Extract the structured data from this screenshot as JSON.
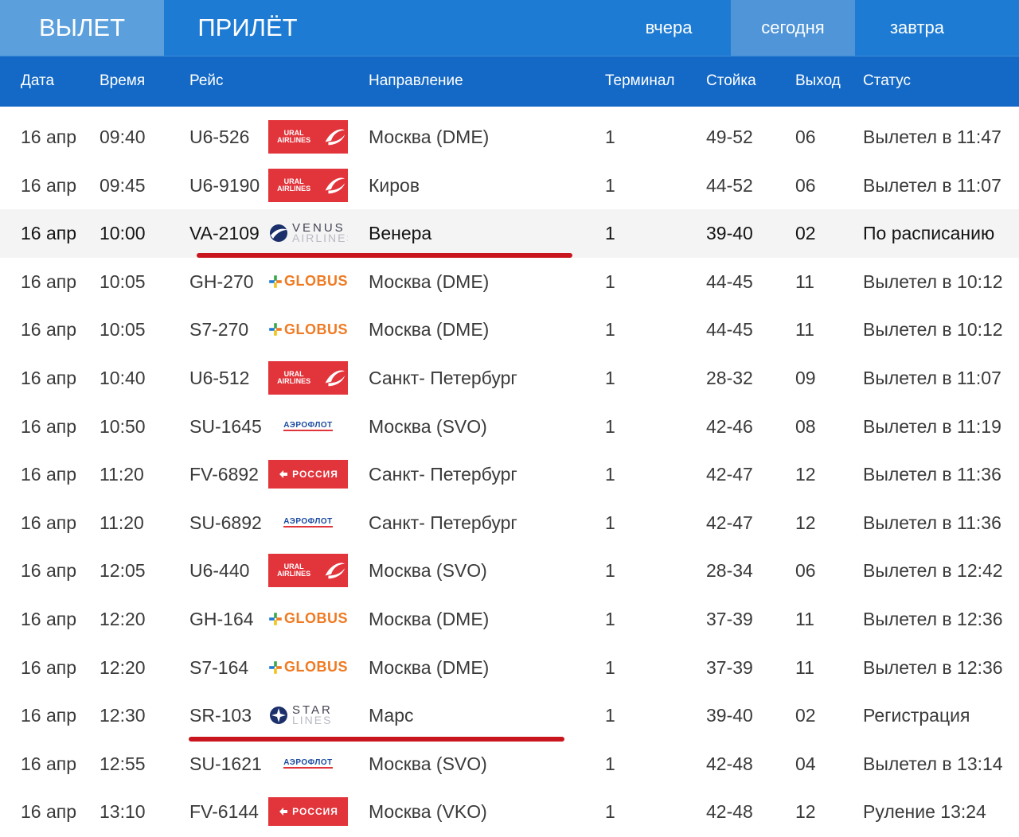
{
  "tabs": {
    "departure": "ВЫЛЕТ",
    "arrival": "ПРИЛЁТ"
  },
  "days": {
    "yesterday": "вчера",
    "today": "сегодня",
    "tomorrow": "завтра"
  },
  "columns": {
    "date": "Дата",
    "time": "Время",
    "flight": "Рейс",
    "direction": "Направление",
    "terminal": "Терминал",
    "desk": "Стойка",
    "gate": "Выход",
    "status": "Статус"
  },
  "colors": {
    "topbar": "#1e7bd3",
    "header": "#1469c6",
    "active_tab": "#5b9fdc",
    "underline": "#c8151e"
  },
  "flights": [
    {
      "date": "16 апр",
      "time": "09:40",
      "flight": "U6-526",
      "airline": "ural",
      "direction": "Москва (DME)",
      "terminal": "1",
      "desk": "49-52",
      "gate": "06",
      "status": "Вылетел в 11:47"
    },
    {
      "date": "16 апр",
      "time": "09:45",
      "flight": "U6-9190",
      "airline": "ural",
      "direction": "Киров",
      "terminal": "1",
      "desk": "44-52",
      "gate": "06",
      "status": "Вылетел в 11:07"
    },
    {
      "date": "16 апр",
      "time": "10:00",
      "flight": "VA-2109",
      "airline": "venus",
      "direction": "Венера",
      "terminal": "1",
      "desk": "39-40",
      "gate": "02",
      "status": "По расписанию",
      "highlight": true,
      "underlined": true
    },
    {
      "date": "16 апр",
      "time": "10:05",
      "flight": "GH-270",
      "airline": "globus",
      "direction": "Москва (DME)",
      "terminal": "1",
      "desk": "44-45",
      "gate": "11",
      "status": "Вылетел в 10:12"
    },
    {
      "date": "16 апр",
      "time": "10:05",
      "flight": "S7-270",
      "airline": "globus",
      "direction": "Москва (DME)",
      "terminal": "1",
      "desk": "44-45",
      "gate": "11",
      "status": "Вылетел в 10:12"
    },
    {
      "date": "16 апр",
      "time": "10:40",
      "flight": "U6-512",
      "airline": "ural",
      "direction": "Санкт- Петербург",
      "terminal": "1",
      "desk": "28-32",
      "gate": "09",
      "status": "Вылетел в 11:07"
    },
    {
      "date": "16 апр",
      "time": "10:50",
      "flight": "SU-1645",
      "airline": "aeroflot",
      "direction": "Москва (SVO)",
      "terminal": "1",
      "desk": "42-46",
      "gate": "08",
      "status": "Вылетел в 11:19"
    },
    {
      "date": "16 апр",
      "time": "11:20",
      "flight": "FV-6892",
      "airline": "rossiya",
      "direction": "Санкт- Петербург",
      "terminal": "1",
      "desk": "42-47",
      "gate": "12",
      "status": "Вылетел в 11:36"
    },
    {
      "date": "16 апр",
      "time": "11:20",
      "flight": "SU-6892",
      "airline": "aeroflot",
      "direction": "Санкт- Петербург",
      "terminal": "1",
      "desk": "42-47",
      "gate": "12",
      "status": "Вылетел в 11:36"
    },
    {
      "date": "16 апр",
      "time": "12:05",
      "flight": "U6-440",
      "airline": "ural",
      "direction": "Москва (SVO)",
      "terminal": "1",
      "desk": "28-34",
      "gate": "06",
      "status": "Вылетел в 12:42"
    },
    {
      "date": "16 апр",
      "time": "12:20",
      "flight": "GH-164",
      "airline": "globus",
      "direction": "Москва (DME)",
      "terminal": "1",
      "desk": "37-39",
      "gate": "11",
      "status": "Вылетел в 12:36"
    },
    {
      "date": "16 апр",
      "time": "12:20",
      "flight": "S7-164",
      "airline": "globus",
      "direction": "Москва (DME)",
      "terminal": "1",
      "desk": "37-39",
      "gate": "11",
      "status": "Вылетел в 12:36"
    },
    {
      "date": "16 апр",
      "time": "12:30",
      "flight": "SR-103",
      "airline": "star",
      "direction": "Марс",
      "terminal": "1",
      "desk": "39-40",
      "gate": "02",
      "status": "Регистрация",
      "underlined": true
    },
    {
      "date": "16 апр",
      "time": "12:55",
      "flight": "SU-1621",
      "airline": "aeroflot",
      "direction": "Москва (SVO)",
      "terminal": "1",
      "desk": "42-48",
      "gate": "04",
      "status": "Вылетел в 13:14"
    },
    {
      "date": "16 апр",
      "time": "13:10",
      "flight": "FV-6144",
      "airline": "rossiya",
      "direction": "Москва (VKO)",
      "terminal": "1",
      "desk": "42-48",
      "gate": "12",
      "status": "Руление 13:24"
    }
  ],
  "logos": {
    "ural": {
      "icon": "ural-airlines-logo",
      "text": "URAL AIRLINES"
    },
    "rossiya": {
      "icon": "rossiya-logo",
      "text": "РОССИЯ"
    },
    "globus": {
      "icon": "globus-logo",
      "text": "GLOBUS"
    },
    "aeroflot": {
      "icon": "aeroflot-logo",
      "text": "АЭРОФЛОТ"
    },
    "venus": {
      "icon": "venus-airlines-logo",
      "l1": "VENUS",
      "l2": "AIRLINES"
    },
    "star": {
      "icon": "star-lines-logo",
      "l1": "STAR",
      "l2": "LINES"
    }
  }
}
